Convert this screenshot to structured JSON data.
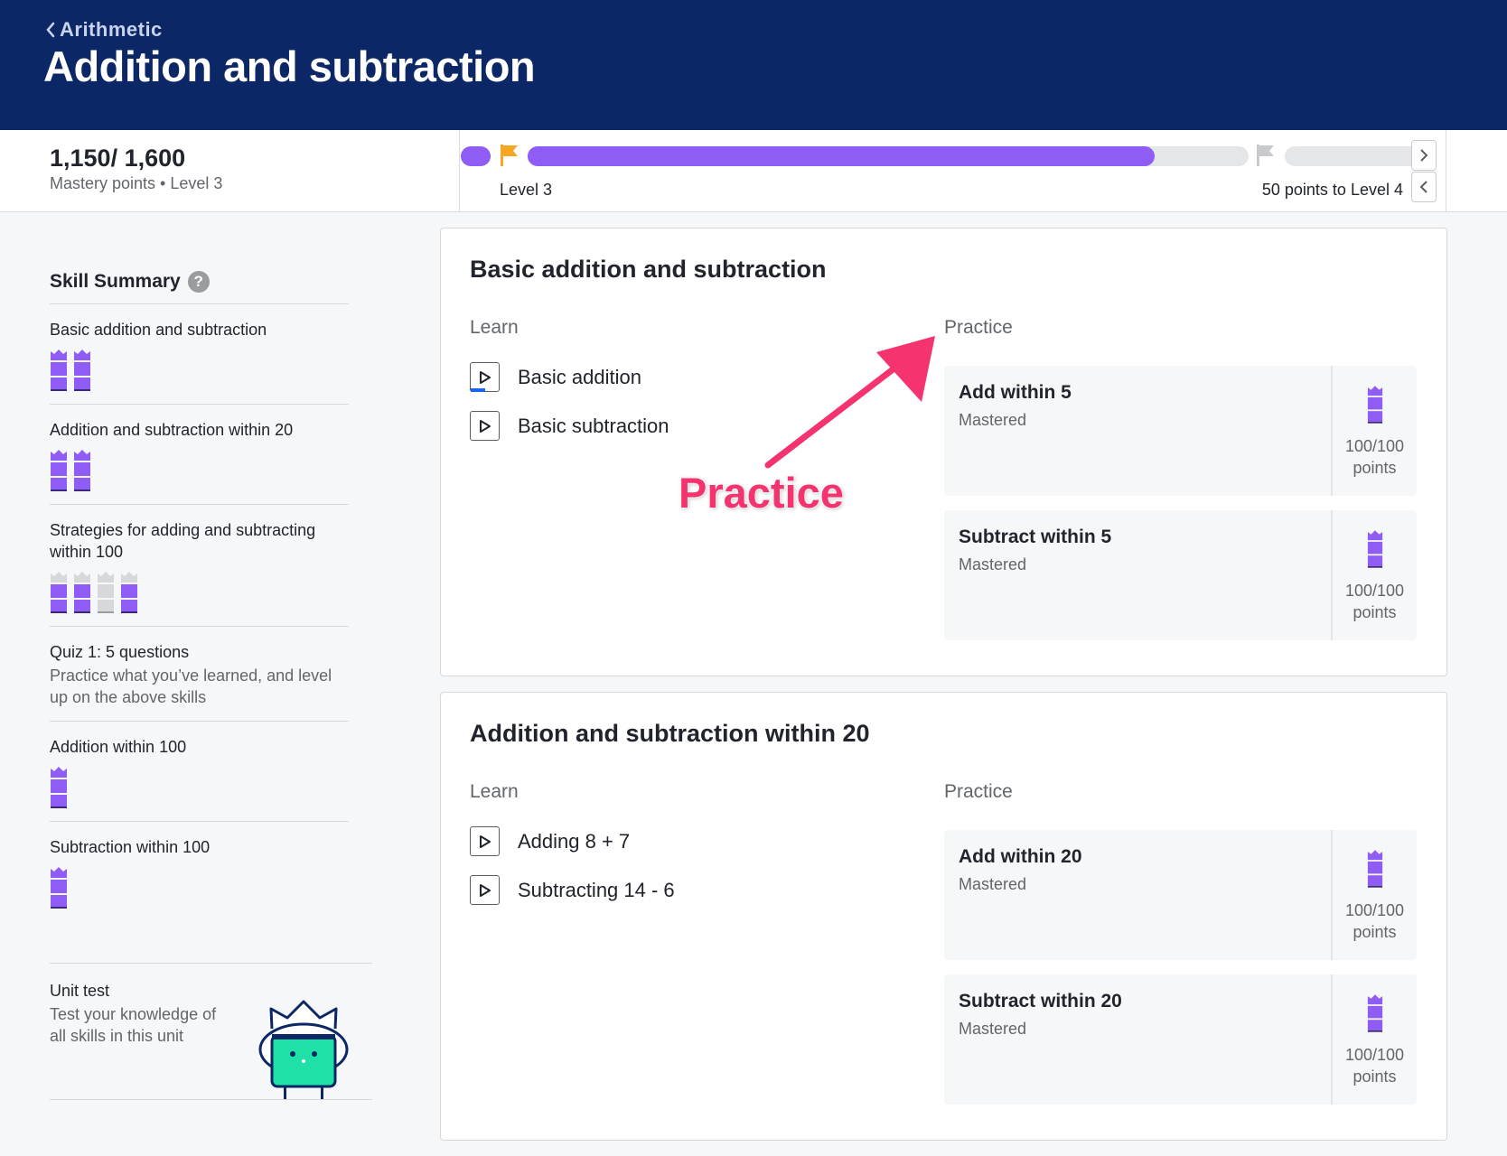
{
  "header": {
    "breadcrumb": "Arithmetic",
    "title": "Addition and subtraction",
    "bg_color": "#0b2765"
  },
  "mastery": {
    "points": "1,150/ 1,600",
    "label": "Mastery points • Level 3",
    "current_level_label": "Level 3",
    "next_level_label": "50 points to Level 4",
    "level_progress_fraction": 0.87,
    "accent_color": "#8f5cf6"
  },
  "sidebar": {
    "title": "Skill Summary",
    "help_icon": "?",
    "items": [
      {
        "name": "Basic addition and subtraction",
        "towers": [
          "full",
          "full"
        ]
      },
      {
        "name": "Addition and subtraction within 20",
        "towers": [
          "full",
          "full"
        ]
      },
      {
        "name": "Strategies for adding and subtracting within 100",
        "towers": [
          "partial",
          "partial",
          "empty",
          "partial"
        ]
      },
      {
        "name": "Quiz 1: 5 questions",
        "desc": "Practice what you’ve learned, and level up on the above skills"
      },
      {
        "name": "Addition within 100",
        "towers": [
          "full"
        ]
      },
      {
        "name": "Subtraction within 100",
        "towers": [
          "full"
        ]
      }
    ],
    "unit_test": {
      "name": "Unit test",
      "desc": "Test your knowledge of all skills in this unit"
    }
  },
  "sections": [
    {
      "title": "Basic addition and subtraction",
      "learn_label": "Learn",
      "practice_label": "Practice",
      "learn": [
        "Basic addition",
        "Basic subtraction"
      ],
      "practice": [
        {
          "title": "Add within 5",
          "status": "Mastered",
          "points": "100/100",
          "unit": "points"
        },
        {
          "title": "Subtract within 5",
          "status": "Mastered",
          "points": "100/100",
          "unit": "points"
        }
      ]
    },
    {
      "title": "Addition and subtraction within 20",
      "learn_label": "Learn",
      "practice_label": "Practice",
      "learn": [
        "Adding 8 + 7",
        "Subtracting 14 - 6"
      ],
      "practice": [
        {
          "title": "Add within 20",
          "status": "Mastered",
          "points": "100/100",
          "unit": "points"
        },
        {
          "title": "Subtract within 20",
          "status": "Mastered",
          "points": "100/100",
          "unit": "points"
        }
      ]
    }
  ],
  "annotation": {
    "text": "Practice",
    "color": "#f5336e"
  }
}
